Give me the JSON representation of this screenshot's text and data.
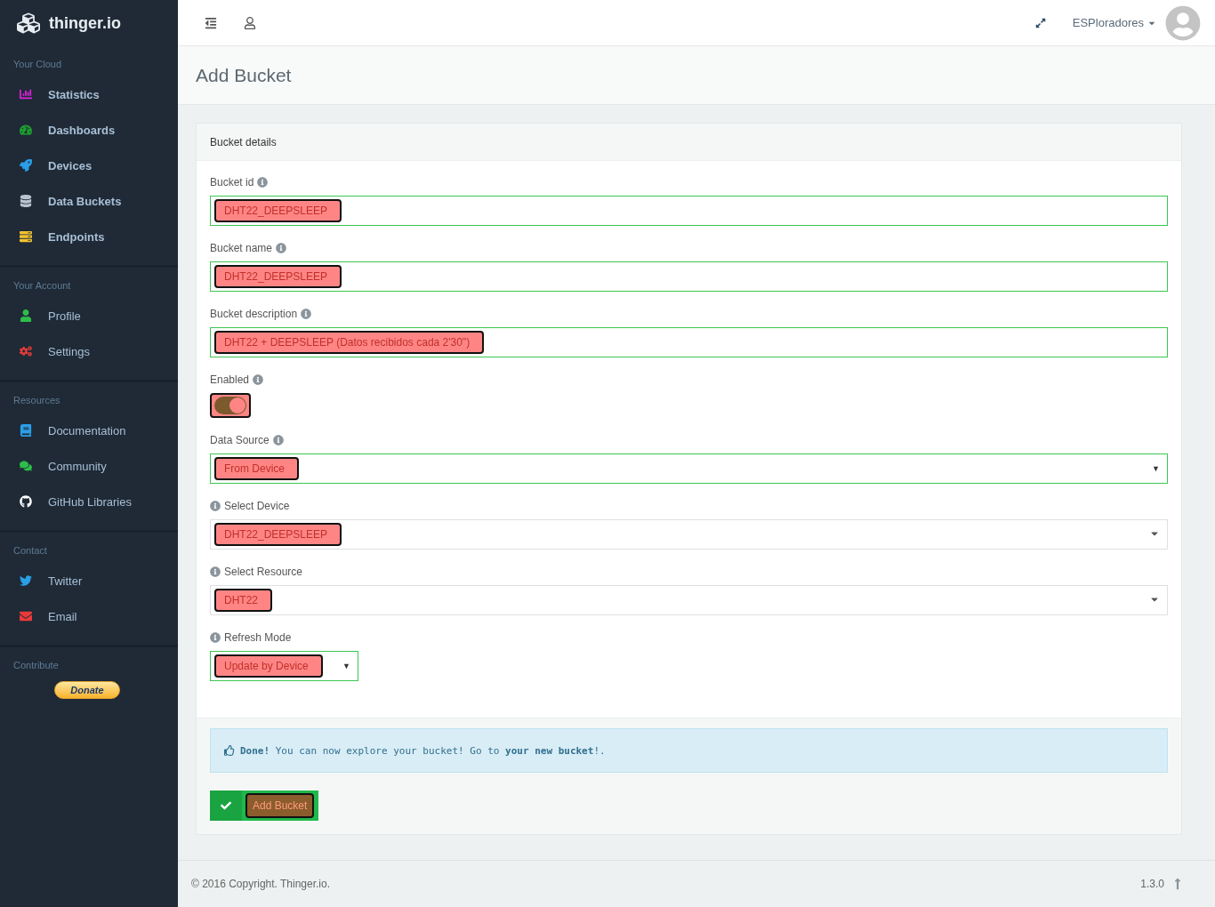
{
  "brand": {
    "name": "thinger.io"
  },
  "sidebar": {
    "sections": [
      {
        "title": "Your Cloud",
        "kind": "bold",
        "items": [
          {
            "label": "Statistics"
          },
          {
            "label": "Dashboards"
          },
          {
            "label": "Devices"
          },
          {
            "label": "Data Buckets"
          },
          {
            "label": "Endpoints"
          }
        ]
      },
      {
        "title": "Your Account",
        "kind": "plain",
        "items": [
          {
            "label": "Profile"
          },
          {
            "label": "Settings"
          }
        ]
      },
      {
        "title": "Resources",
        "kind": "plain",
        "items": [
          {
            "label": "Documentation"
          },
          {
            "label": "Community"
          },
          {
            "label": "GitHub Libraries"
          }
        ]
      },
      {
        "title": "Contact",
        "kind": "plain",
        "items": [
          {
            "label": "Twitter"
          },
          {
            "label": "Email"
          }
        ]
      },
      {
        "title": "Contribute",
        "kind": "donate",
        "button": "Donate"
      }
    ]
  },
  "topbar": {
    "user": "ESPloradores"
  },
  "page": {
    "title": "Add Bucket"
  },
  "form": {
    "title": "Bucket details",
    "fields": [
      {
        "kind": "text",
        "label": "Bucket id",
        "info_first": false,
        "valid": true,
        "value": "DHT22_DEEPSLEEP"
      },
      {
        "kind": "text",
        "label": "Bucket name",
        "info_first": false,
        "valid": true,
        "value": "DHT22_DEEPSLEEP"
      },
      {
        "kind": "text",
        "label": "Bucket description",
        "info_first": false,
        "valid": true,
        "value": "DHT22 + DEEPSLEEP (Datos recibidos cada 2'30\")"
      },
      {
        "kind": "toggle",
        "label": "Enabled",
        "info_first": false,
        "on": true
      },
      {
        "kind": "native-select",
        "label": "Data Source",
        "info_first": false,
        "valid": true,
        "value": "From Device",
        "caret": "▼"
      },
      {
        "kind": "select",
        "label": "Select Device",
        "info_first": true,
        "valid": false,
        "value": "DHT22_DEEPSLEEP"
      },
      {
        "kind": "select",
        "label": "Select Resource",
        "info_first": true,
        "valid": false,
        "value": "DHT22"
      },
      {
        "kind": "compact-select",
        "label": "Refresh Mode",
        "info_first": true,
        "valid": true,
        "value": "Update by Device",
        "caret": "▼"
      }
    ],
    "alert": "**Done!** You can now explore your bucket! Go to **your new bucket**!.",
    "submit": "Add Bucket"
  },
  "footer": {
    "copyright": "© 2016 Copyright. Thinger.io.",
    "version": "1.3.0"
  }
}
